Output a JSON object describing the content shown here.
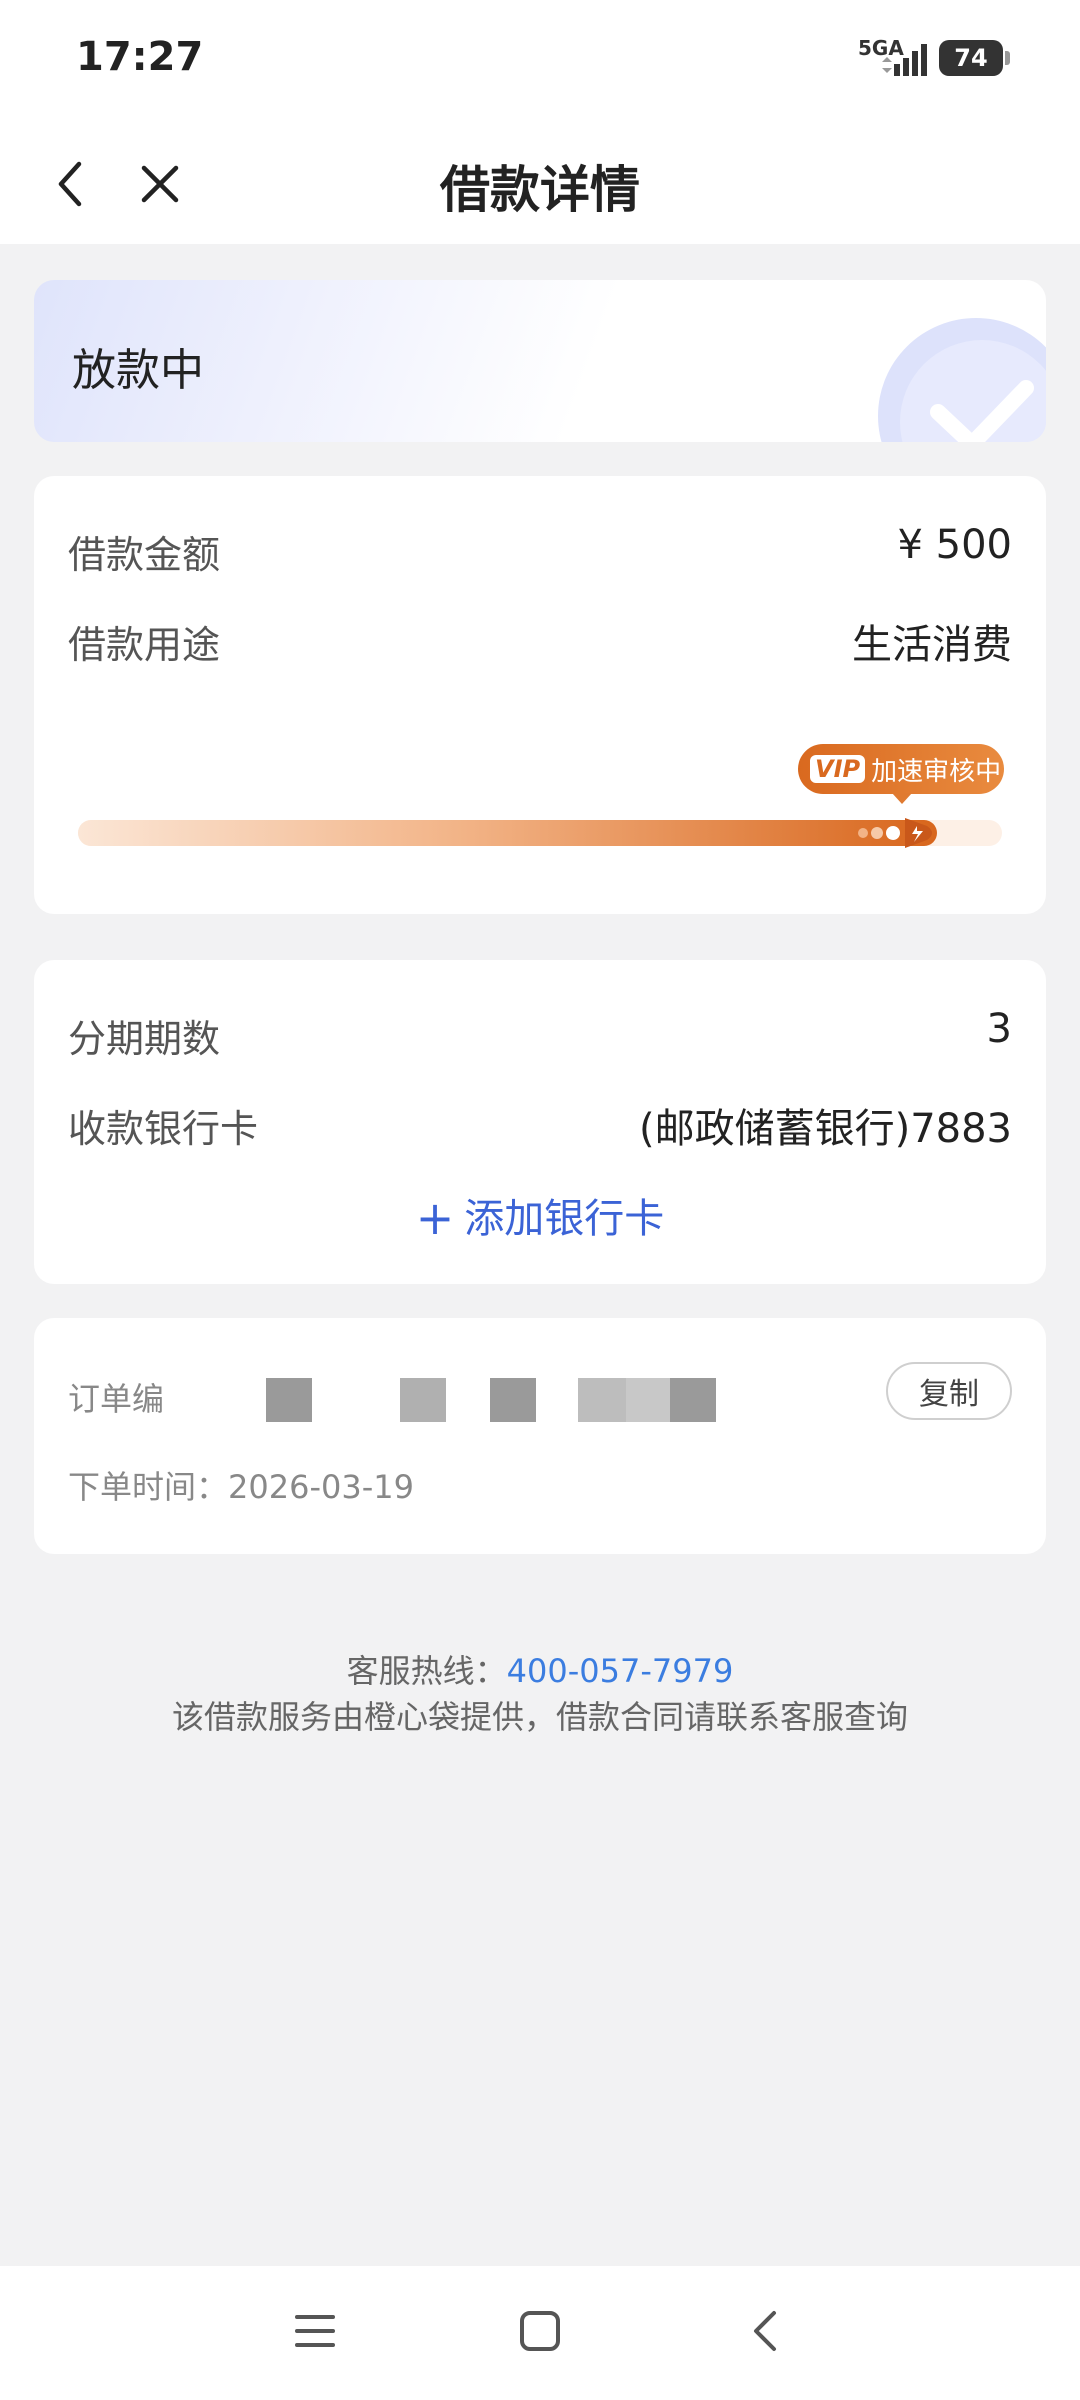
{
  "status_bar": {
    "time": "17:27",
    "network": "5GA",
    "battery": "74"
  },
  "header": {
    "title": "借款详情"
  },
  "status_card": {
    "text": "放款中"
  },
  "loan": {
    "amount_label": "借款金额",
    "amount_value": "¥ 500",
    "purpose_label": "借款用途",
    "purpose_value": "生活消费",
    "vip_badge": "VIP",
    "vip_text": "加速审核中",
    "progress": 0.93
  },
  "repayment": {
    "periods_label": "分期期数",
    "periods_value": "3",
    "bank_label": "收款银行卡",
    "bank_value": "(邮政储蓄银行)7883",
    "add_card_label": "添加银行卡"
  },
  "order": {
    "order_no_label": "订单编",
    "copy_label": "复制",
    "time_text": "下单时间：2026-03-19"
  },
  "footer": {
    "hotline_label": "客服热线：",
    "hotline_number": "400-057-7979",
    "note": "该借款服务由橙心袋提供，借款合同请联系客服查询"
  },
  "colors": {
    "accent_blue": "#3b63d6",
    "vip_orange": "#d9691f",
    "link_blue": "#3b7de0"
  },
  "icons": {
    "back": "chevron-left-icon",
    "close": "close-icon",
    "check": "check-icon",
    "rocket": "rocket-icon",
    "plus": "plus-icon",
    "nav_menu": "menu-icon",
    "nav_home": "home-square-icon",
    "nav_back": "chevron-left-icon"
  }
}
